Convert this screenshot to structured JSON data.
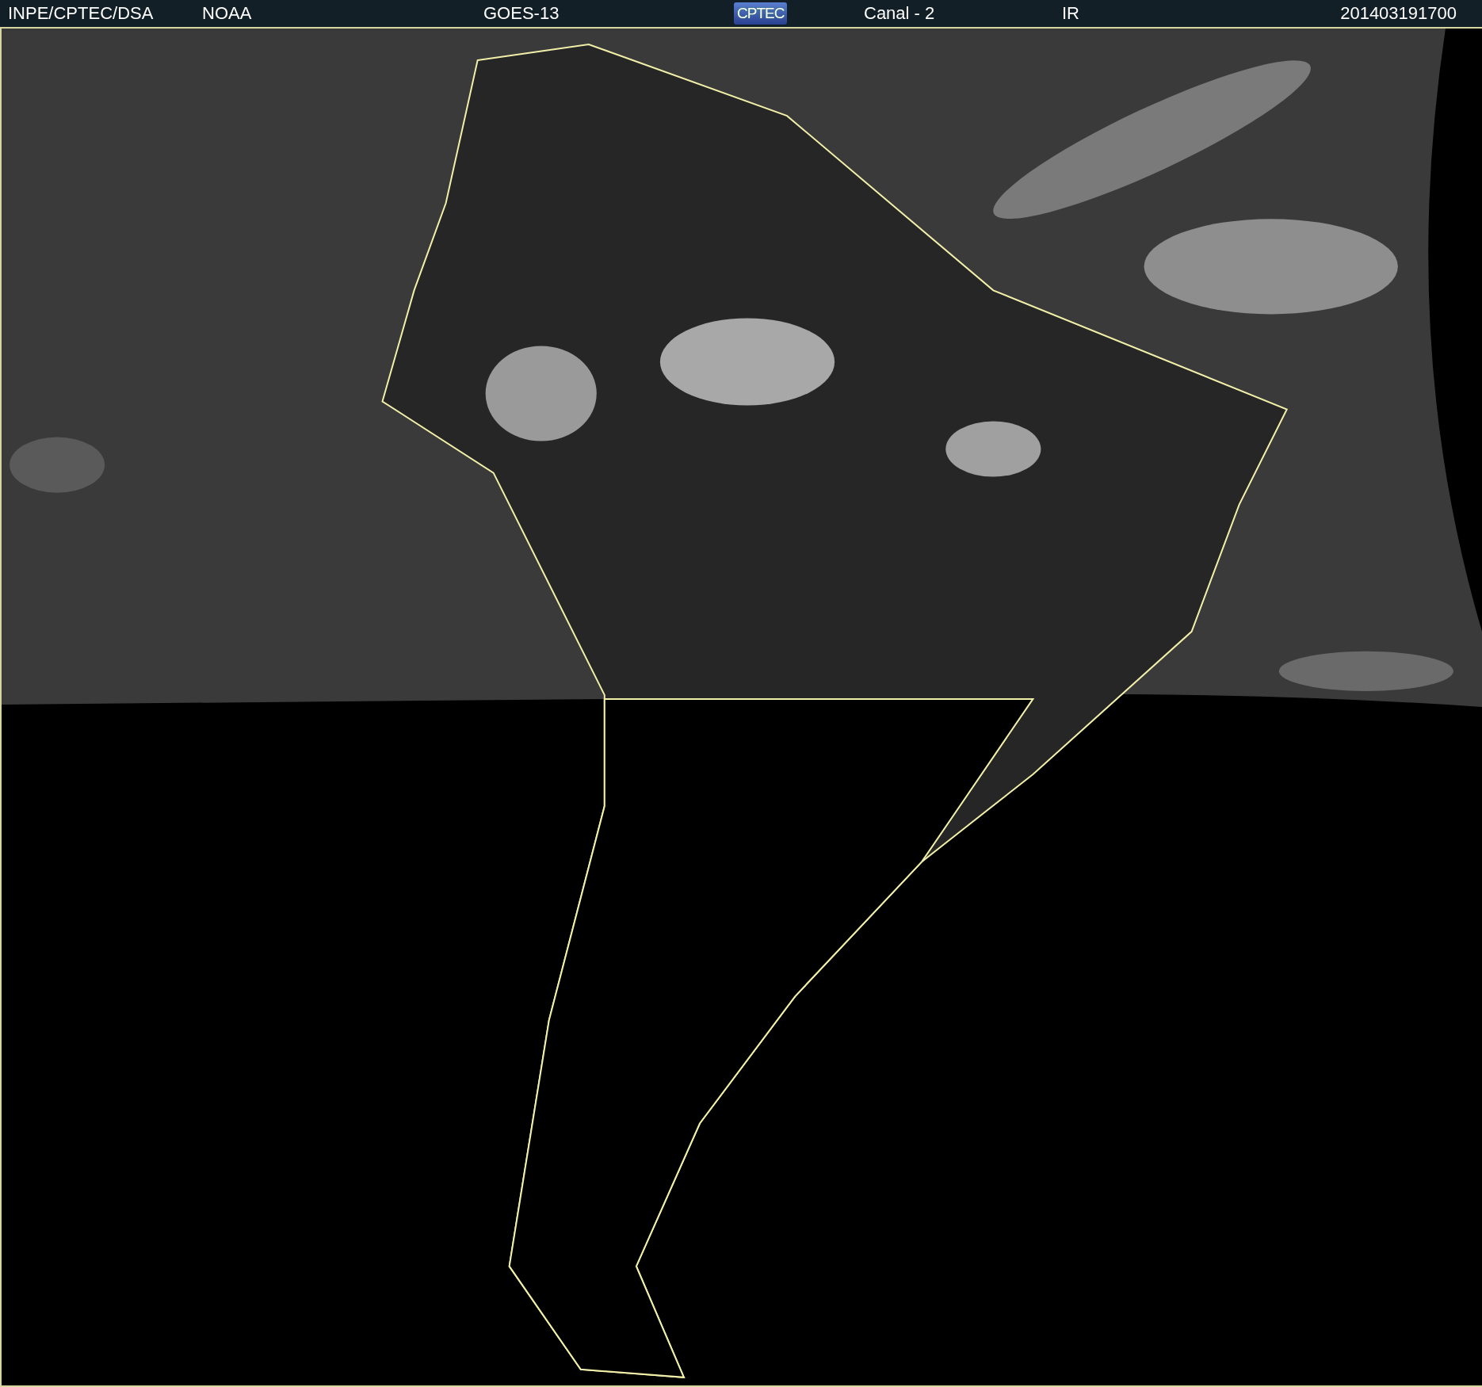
{
  "header": {
    "items": [
      {
        "kind": "text",
        "text": "INPE/CPTEC/DSA"
      },
      {
        "kind": "text",
        "text": "NOAA"
      },
      {
        "kind": "text",
        "text": "GOES-13"
      },
      {
        "kind": "logo",
        "text": "CPTEC"
      },
      {
        "kind": "text",
        "text": "Canal - 2"
      },
      {
        "kind": "text",
        "text": "IR"
      },
      {
        "kind": "text",
        "text": "201403191700"
      }
    ]
  }
}
